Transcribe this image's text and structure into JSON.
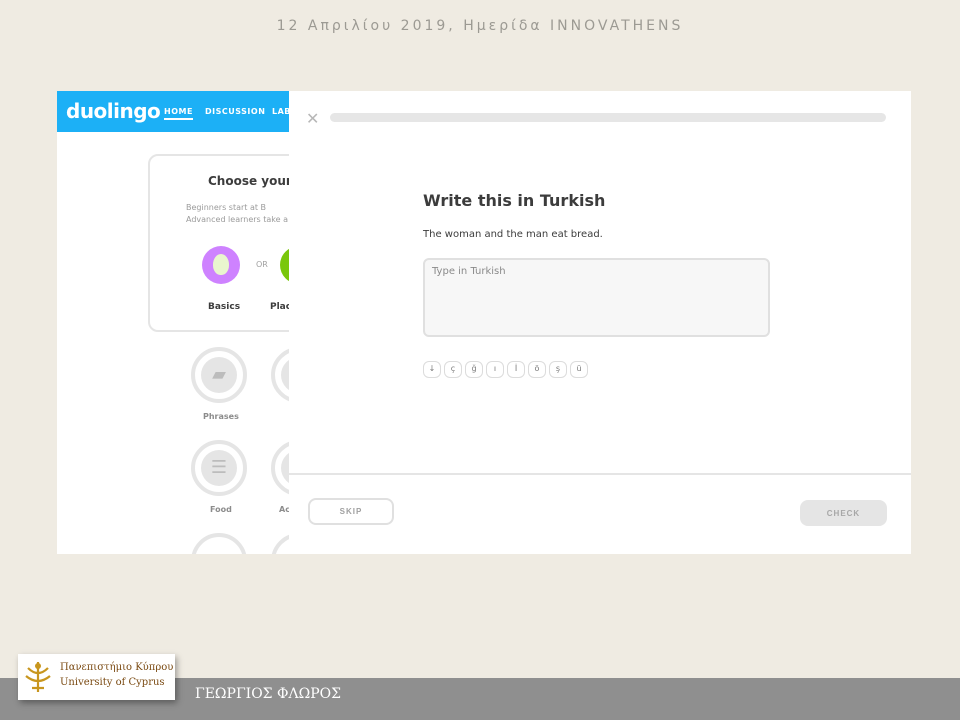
{
  "slide": {
    "header": "12 Απριλίου 2019, Ημερίδα INNOVATHENS",
    "presenter": "ΓΕΩΡΓΙΟΣ ΦΛΩΡΟΣ",
    "university_greek": "Πανεπιστήμιο Κύπρου",
    "university_english": "University of Cyprus"
  },
  "app": {
    "logo": "duolingo",
    "nav": [
      "HOME",
      "DISCUSSION",
      "LAB"
    ],
    "card": {
      "title": "Choose your p",
      "desc_line1": "Beginners start at B",
      "desc_line2": "Advanced learners take a",
      "or": "OR",
      "option_a": "Basics",
      "option_b": "Plac"
    },
    "skills": [
      "Phrases",
      "Food",
      "Ac"
    ]
  },
  "lesson": {
    "progress": 0.0,
    "title": "Write this in Turkish",
    "sentence": "The woman and the man eat bread.",
    "answer_placeholder": "Type in Turkish",
    "answer_value": "",
    "special_keys": [
      "↓",
      "ç",
      "ğ",
      "ı",
      "İ",
      "ö",
      "ş",
      "ü"
    ],
    "skip_label": "SKIP",
    "check_label": "CHECK"
  },
  "colors": {
    "duolingo_blue": "#1cb0f6",
    "egg_purple": "#ce82ff",
    "accent_green": "#7ac70c"
  }
}
